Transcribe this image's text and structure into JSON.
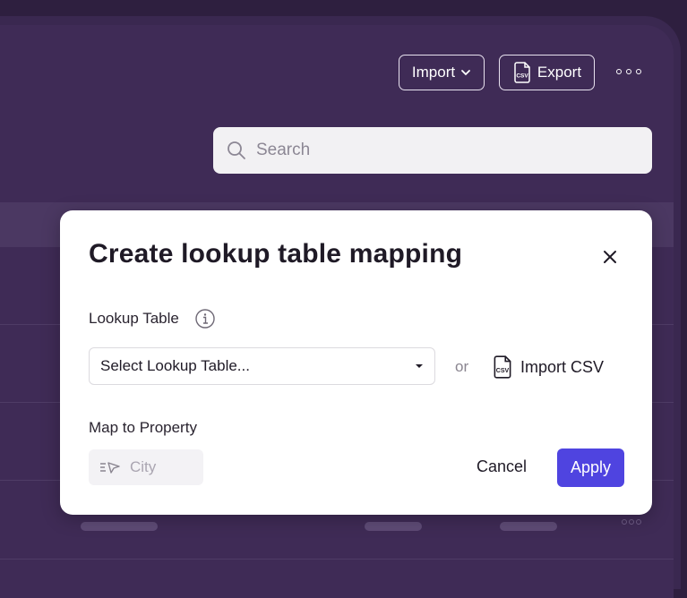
{
  "toolbar": {
    "import_label": "Import",
    "export_label": "Export"
  },
  "search": {
    "placeholder": "Search"
  },
  "modal": {
    "title": "Create lookup table mapping",
    "lookup_table_label": "Lookup Table",
    "select_value": "Select Lookup Table...",
    "or_text": "or",
    "import_csv_label": "Import CSV",
    "map_to_property_label": "Map to Property",
    "property_value": "City",
    "cancel_label": "Cancel",
    "apply_label": "Apply"
  },
  "colors": {
    "background": "#3f2b56",
    "accent": "#4f44e0",
    "modal_bg": "#ffffff"
  },
  "icons": [
    "chevron-down-icon",
    "csv-file-icon",
    "more-icon",
    "search-icon",
    "close-icon",
    "info-icon",
    "caret-down-icon",
    "property-icon"
  ]
}
